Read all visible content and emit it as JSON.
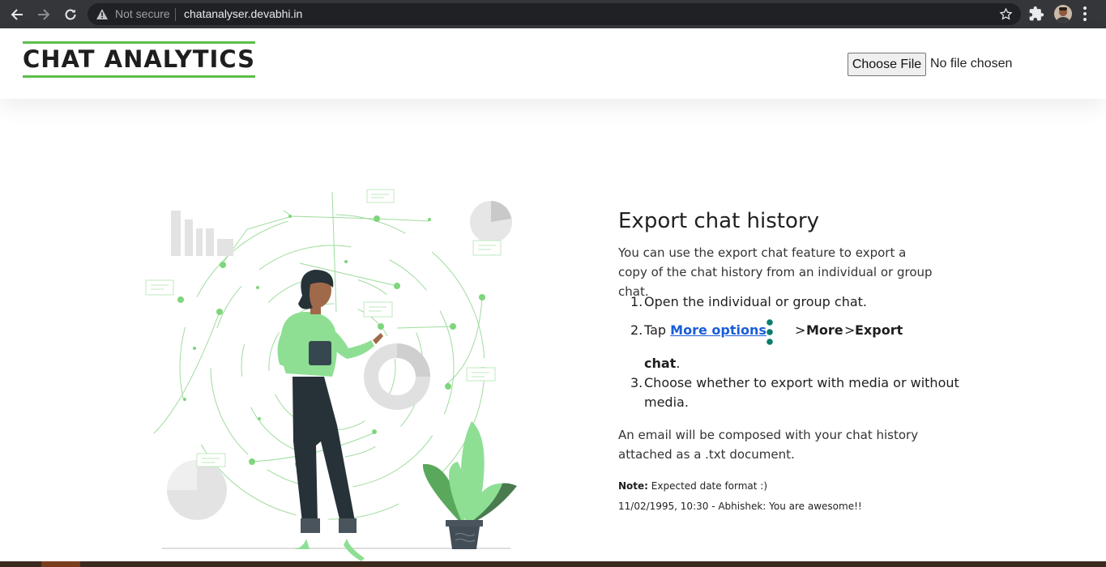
{
  "browser": {
    "security_label": "Not secure",
    "url": "chatanalyser.devabhi.in"
  },
  "header": {
    "logo_text": "CHAT ANALYTICS",
    "file_button_label": "Choose File",
    "file_status": "No file chosen"
  },
  "content": {
    "title": "Export chat history",
    "intro": "You can use the export chat feature to export a copy of the chat history from an individual or group chat.",
    "steps": [
      {
        "number": "1.",
        "text": "Open the individual or group chat."
      },
      {
        "number": "2.",
        "prefix": "Tap ",
        "link": "More options",
        "sep1": ">",
        "more": "More",
        "sep2": ">",
        "export": "Export",
        "chat": "chat",
        "end": "."
      },
      {
        "number": "3.",
        "line1": "Choose whether to export with media or without",
        "line2": "media."
      }
    ],
    "email_note": "An email will be composed with your chat history attached as a .txt document.",
    "note_label": "Note:",
    "note_text": " Expected date format :)",
    "sample_line": "11/02/1995, 10:30 - Abhishek: You are awesome!!"
  },
  "colors": {
    "accent_green": "#5cbf4a",
    "link_blue": "#1a5dd8",
    "kebab_teal": "#0b7d6e",
    "chrome_dark": "#35363a"
  },
  "icons": [
    "back-arrow-icon",
    "forward-arrow-icon",
    "reload-icon",
    "warning-icon",
    "star-icon",
    "extensions-puzzle-icon",
    "profile-avatar",
    "menu-kebab-icon",
    "more-options-kebab-icon"
  ]
}
